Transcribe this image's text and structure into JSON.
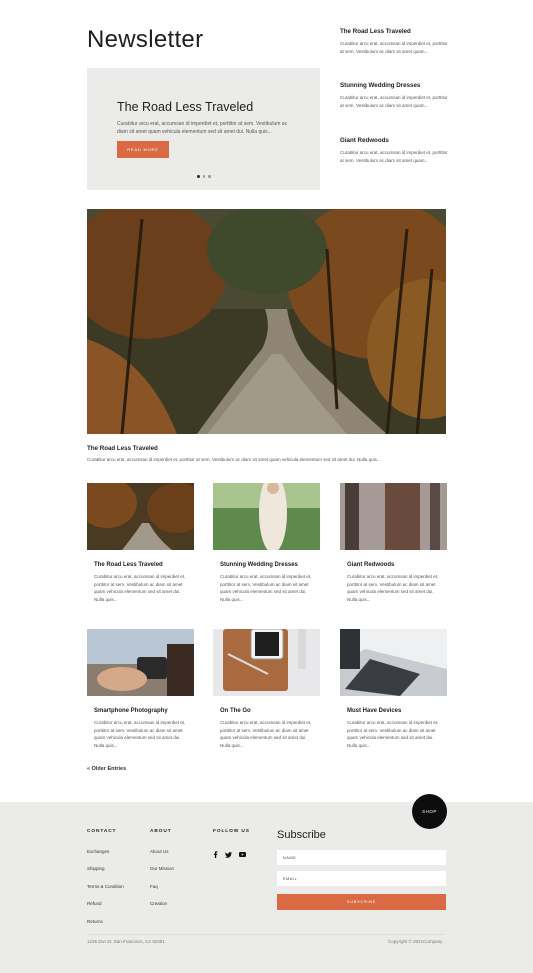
{
  "page": {
    "title": "Newsletter"
  },
  "slider": {
    "title": "The Road Less Traveled",
    "excerpt": "Curabitur arcu erat, accumsan id imperdiet et, porttitor at sem. Vestibulum ac diam sit amet quam vehicula elementum sed sit amet dui. Nulla quis...",
    "button_label": "READ MORE",
    "dots": 3,
    "active_dot": 0
  },
  "side_posts": [
    {
      "title": "The Road Less Traveled",
      "excerpt": "Curabitur arcu erat, accumsan id imperdiet et, porttitor at sem. Vestibulum ac diam sit amet quam..."
    },
    {
      "title": "Stunning Wedding Dresses",
      "excerpt": "Curabitur arcu erat, accumsan id imperdiet et, porttitor at sem. Vestibulum ac diam sit amet quam..."
    },
    {
      "title": "Giant Redwoods",
      "excerpt": "Curabitur arcu erat, accumsan id imperdiet et, porttitor at sem. Vestibulum ac diam sit amet quam..."
    }
  ],
  "featured": {
    "title": "The Road Less Traveled",
    "excerpt": "Curabitur arcu erat, accumsan id imperdiet et, porttitor at sem. Vestibulum ac diam sit amet quam vehicula elementum sed sit amet dui. Nulla quis..."
  },
  "grid_posts": [
    {
      "title": "The Road Less Traveled",
      "excerpt": "Curabitur arcu erat, accumsan id imperdiet et, porttitor at sem. Vestibulum ac diam sit amet quam vehicula elementum sed sit amet dui. Nulla quis..."
    },
    {
      "title": "Stunning Wedding Dresses",
      "excerpt": "Curabitur arcu erat, accumsan id imperdiet et, porttitor at sem. Vestibulum ac diam sit amet quam vehicula elementum sed sit amet dui. Nulla quis..."
    },
    {
      "title": "Giant Redwoods",
      "excerpt": "Curabitur arcu erat, accumsan id imperdiet et, porttitor at sem. Vestibulum ac diam sit amet quam vehicula elementum sed sit amet dui. Nulla quis..."
    },
    {
      "title": "Smartphone Photography",
      "excerpt": "Curabitur arcu erat, accumsan id imperdiet et, porttitor at sem. Vestibulum ac diam sit amet quam vehicula elementum sed sit amet dui. Nulla quis..."
    },
    {
      "title": "On The Go",
      "excerpt": "Curabitur arcu erat, accumsan id imperdiet et, porttitor at sem. Vestibulum ac diam sit amet quam vehicula elementum sed sit amet dui. Nulla quis..."
    },
    {
      "title": "Must Have Devices",
      "excerpt": "Curabitur arcu erat, accumsan id imperdiet et, porttitor at sem. Vestibulum ac diam sit amet quam vehicula elementum sed sit amet dui. Nulla quis..."
    }
  ],
  "pagination": {
    "older_label": "« Older Entries"
  },
  "shop_button": "SHOP",
  "footer": {
    "contact": {
      "heading": "CONTACT",
      "links": [
        "Exchanges",
        "Shipping",
        "Terms & Condition",
        "Refund",
        "Returns"
      ]
    },
    "about": {
      "heading": "ABOUT",
      "links": [
        "About Us",
        "Our Mission",
        "Faq",
        "Creation"
      ]
    },
    "follow": {
      "heading": "FOLLOW US",
      "icons": [
        "facebook-icon",
        "twitter-icon",
        "youtube-icon"
      ]
    },
    "subscribe": {
      "title": "Subscribe",
      "name_placeholder": "NAME",
      "email_placeholder": "EMAIL",
      "button_label": "SUBSCRIBE"
    },
    "address": "1235 Divi St. San Francisco, CA 92351",
    "copyright": "Copyright © 2021Company"
  },
  "colors": {
    "accent": "#d96a43",
    "panel": "#ebecea",
    "dark": "#0d0d0d"
  }
}
